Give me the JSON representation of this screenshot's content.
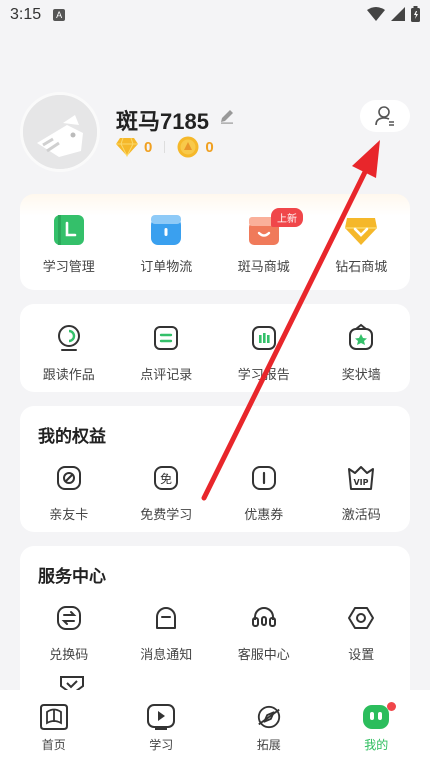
{
  "status_bar": {
    "time": "3:15",
    "notification_letter": "A"
  },
  "profile": {
    "username": "斑马7185",
    "diamonds": "0",
    "coins": "0"
  },
  "quick_menu": [
    {
      "label": "学习管理",
      "icon": "study-manage-icon",
      "color": "#34c06a"
    },
    {
      "label": "订单物流",
      "icon": "order-logistics-icon",
      "color": "#3aa0ef"
    },
    {
      "label": "斑马商城",
      "icon": "zebra-mall-icon",
      "color": "#f07a5a",
      "badge": "上新"
    },
    {
      "label": "钻石商城",
      "icon": "diamond-mall-icon",
      "color": "#f5b82a"
    }
  ],
  "records_menu": [
    {
      "label": "跟读作品",
      "icon": "read-along-icon"
    },
    {
      "label": "点评记录",
      "icon": "review-record-icon"
    },
    {
      "label": "学习报告",
      "icon": "study-report-icon"
    },
    {
      "label": "奖状墙",
      "icon": "certificate-wall-icon"
    }
  ],
  "benefits": {
    "title": "我的权益",
    "items": [
      {
        "label": "亲友卡",
        "icon": "friend-card-icon"
      },
      {
        "label": "免费学习",
        "icon": "free-study-icon",
        "glyph": "免"
      },
      {
        "label": "优惠券",
        "icon": "coupon-icon"
      },
      {
        "label": "激活码",
        "icon": "activation-code-icon",
        "glyph": "VIP"
      }
    ]
  },
  "service": {
    "title": "服务中心",
    "items": [
      {
        "label": "兑换码",
        "icon": "redeem-code-icon"
      },
      {
        "label": "消息通知",
        "icon": "message-notification-icon"
      },
      {
        "label": "客服中心",
        "icon": "customer-service-icon"
      },
      {
        "label": "设置",
        "icon": "settings-icon"
      }
    ]
  },
  "tabbar": [
    {
      "label": "首页",
      "icon": "home-icon"
    },
    {
      "label": "学习",
      "icon": "learn-icon"
    },
    {
      "label": "拓展",
      "icon": "explore-icon"
    },
    {
      "label": "我的",
      "icon": "mine-icon",
      "active": true
    }
  ],
  "colors": {
    "accent": "#2bbd5c",
    "coin": "#f0a020",
    "badge": "#f0464a",
    "annotation": "#e8262b"
  }
}
